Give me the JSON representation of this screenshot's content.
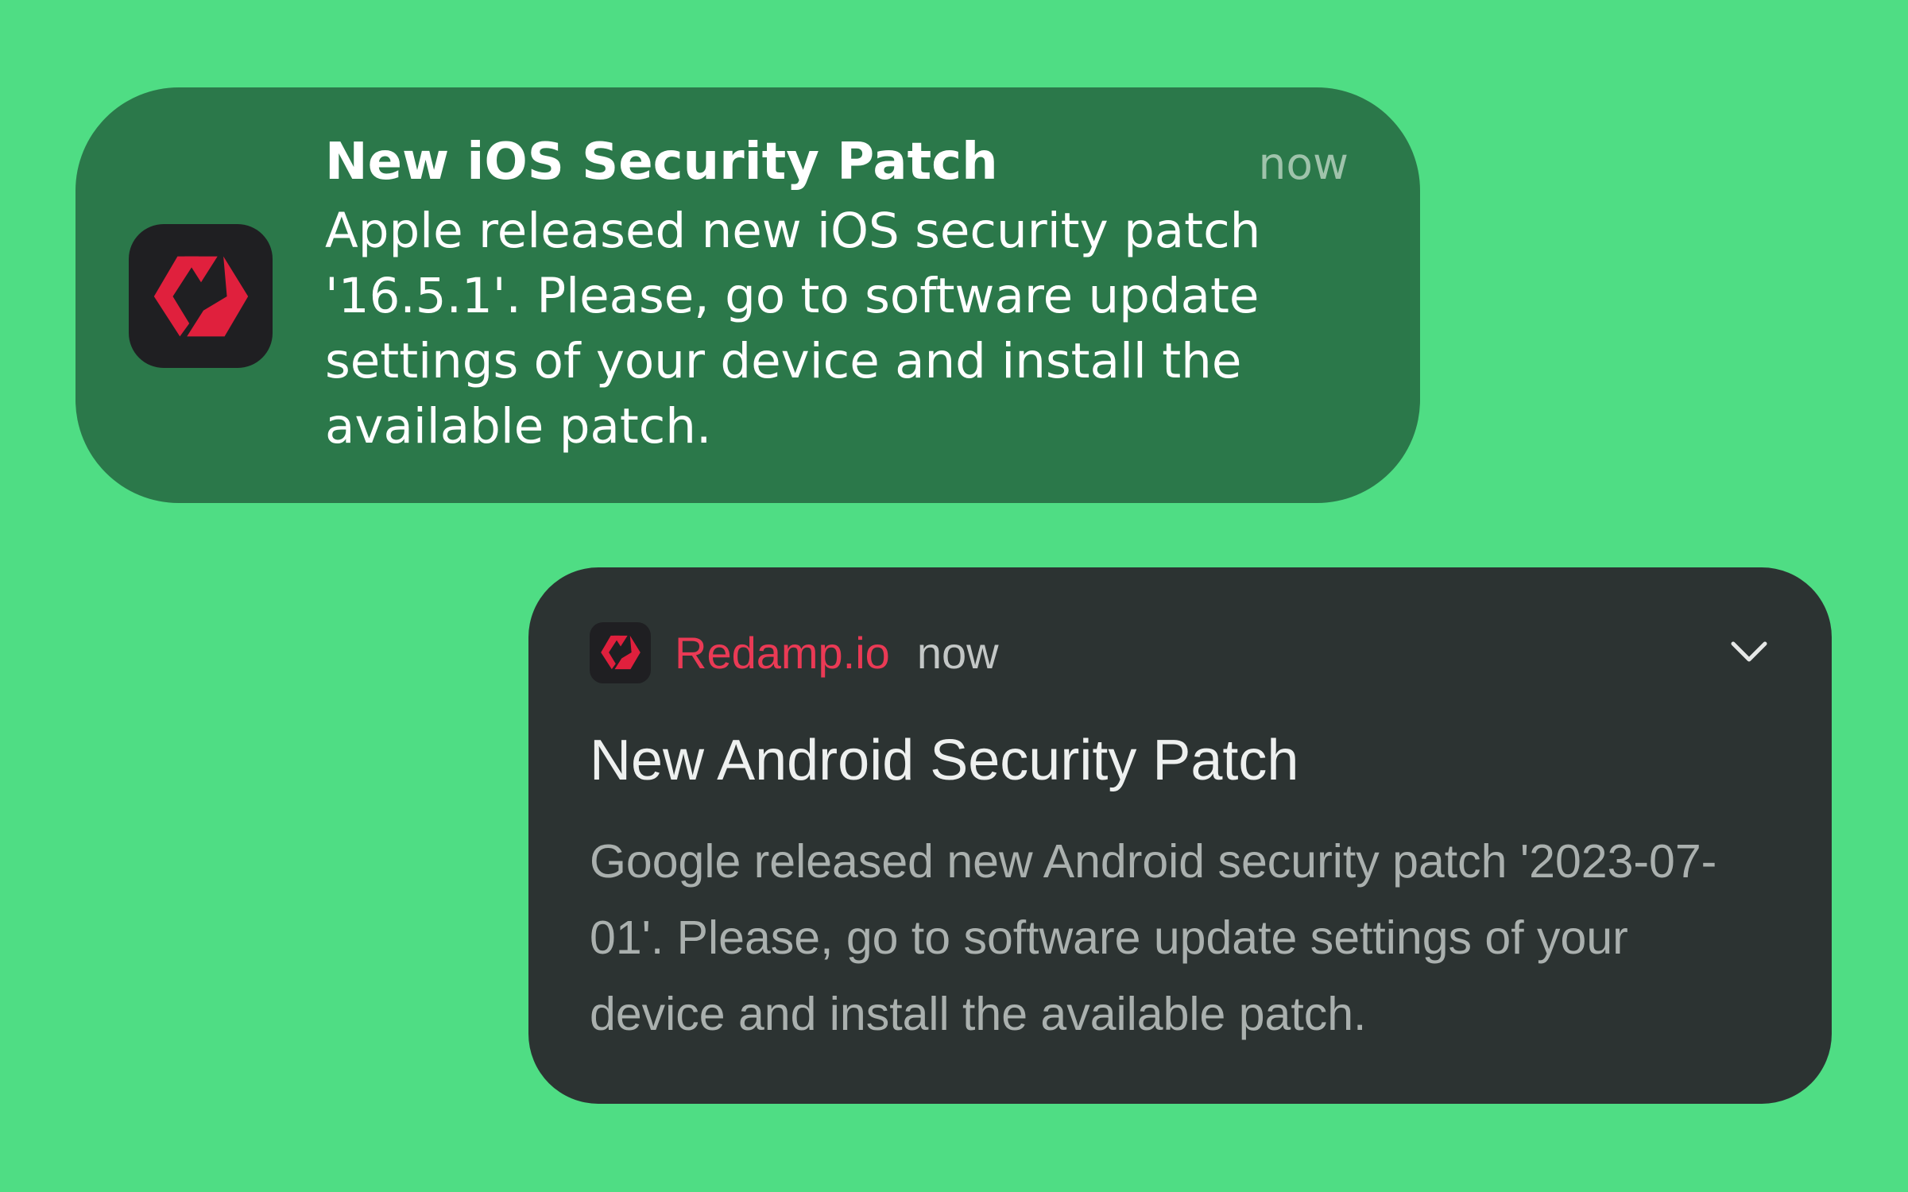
{
  "background_color": "#4fdd84",
  "ios_notification": {
    "title": "New iOS Security Patch",
    "time": "now",
    "body": "Apple released new iOS security patch '16.5.1'. Please, go to software update settings of your device and install the available patch.",
    "icon": "redamp-logo-icon",
    "card_color": "#2b784a"
  },
  "android_notification": {
    "app_name": "Redamp.io",
    "time": "now",
    "title": "New Android Security Patch",
    "body": "Google released new Android security patch '2023-07-01'. Please, go to software update settings of your device and install the available patch.",
    "icon": "redamp-logo-icon",
    "expand_icon": "chevron-down-icon",
    "card_color": "#2c3332",
    "accent_color": "#ea3a55"
  }
}
